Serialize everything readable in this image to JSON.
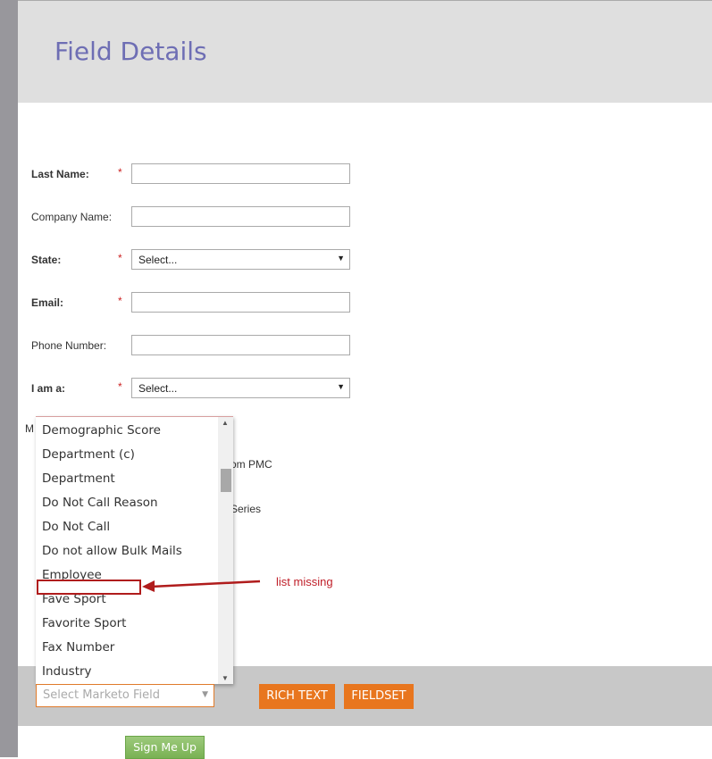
{
  "header": {
    "title": "Field Details"
  },
  "form": {
    "fields": [
      {
        "label": "Last Name:",
        "required": true,
        "type": "text",
        "value": ""
      },
      {
        "label": "Company Name:",
        "required": false,
        "type": "text",
        "value": ""
      },
      {
        "label": "State:",
        "required": true,
        "type": "select",
        "value": "Select..."
      },
      {
        "label": "Email:",
        "required": true,
        "type": "text",
        "value": ""
      },
      {
        "label": "Phone Number:",
        "required": false,
        "type": "text",
        "value": ""
      },
      {
        "label": "I am a:",
        "required": true,
        "type": "select",
        "value": "Select..."
      }
    ],
    "required_marker": "*",
    "hidden_fragments": [
      "M",
      "om PMC",
      "Series"
    ]
  },
  "dropdown": {
    "items": [
      "Demographic Score",
      "Department (c)",
      "Department",
      "Do Not Call Reason",
      "Do Not Call",
      "Do not allow Bulk Mails",
      "Employee",
      "Fave Sport",
      "Favorite Sport",
      "Fax Number",
      "Industry"
    ]
  },
  "toolbar": {
    "select_placeholder": "Select Marketo Field",
    "rich_text": "RICH TEXT",
    "fieldset": "FIELDSET"
  },
  "submit": {
    "label": "Sign Me Up"
  },
  "annotation": {
    "text": "list missing",
    "color": "#c0202a"
  },
  "colors": {
    "title": "#6e6eb4",
    "accent": "#e8761e",
    "submit": "#79b153"
  }
}
